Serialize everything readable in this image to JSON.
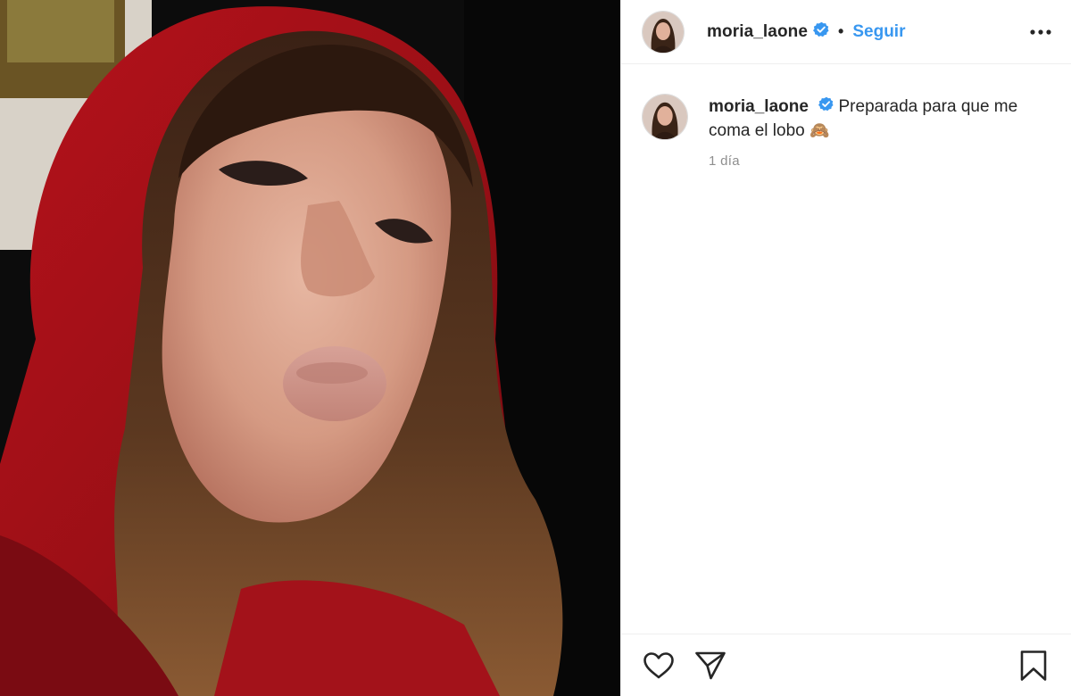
{
  "post": {
    "image_alt": "Selfie de mujer con capucha roja lanzando un beso"
  },
  "header": {
    "username": "moria_laone",
    "separator": "•",
    "follow_label": "Seguir",
    "verified_icon": "verified-badge-icon",
    "more_icon": "more-options-icon"
  },
  "caption": {
    "username": "moria_laone",
    "text": "Preparada para que me coma el lobo",
    "emoji": "🙈",
    "time": "1 día"
  },
  "actions": {
    "like_icon": "heart-icon",
    "share_icon": "paper-plane-icon",
    "save_icon": "bookmark-icon"
  },
  "colors": {
    "link_blue": "#3897f0",
    "verified_blue": "#3897f0",
    "muted": "#8e8e8e",
    "text": "#262626"
  }
}
